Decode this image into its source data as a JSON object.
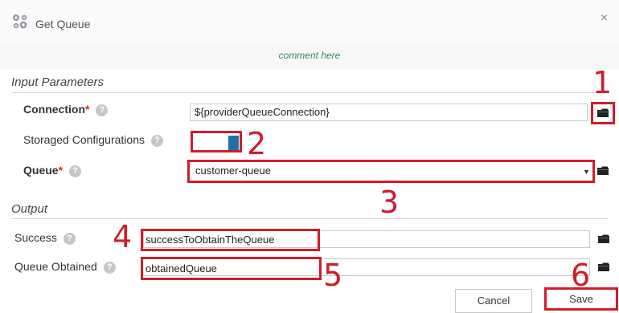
{
  "window": {
    "title": "Get Queue",
    "close_glyph": "×",
    "app_icon": "gear-cluster-icon"
  },
  "comment": "comment here",
  "input_parameters": {
    "heading": "Input Parameters",
    "connection": {
      "label": "Connection",
      "required_mark": "*",
      "value": "${providerQueueConnection}",
      "browse_icon": "folder-icon"
    },
    "storaged_configurations": {
      "label": "Storaged Configurations",
      "toggle_on": true
    },
    "queue": {
      "label": "Queue",
      "required_mark": "*",
      "value": "customer-queue",
      "browse_icon": "folder-icon"
    }
  },
  "output": {
    "heading": "Output",
    "success": {
      "label": "Success",
      "value": "successToObtainTheQueue",
      "browse_icon": "folder-icon"
    },
    "queue_obtained": {
      "label": "Queue Obtained",
      "value": "obtainedQueue",
      "browse_icon": "folder-icon"
    }
  },
  "help_glyph": "?",
  "buttons": {
    "cancel": "Cancel",
    "save": "Save"
  },
  "annotations": [
    "1",
    "2",
    "3",
    "4",
    "5",
    "6"
  ],
  "colors": {
    "annotation_red": "#d01c2c",
    "toggle_blue": "#1d72a8",
    "comment_green": "#2e8b57",
    "required_red": "#e02020"
  }
}
